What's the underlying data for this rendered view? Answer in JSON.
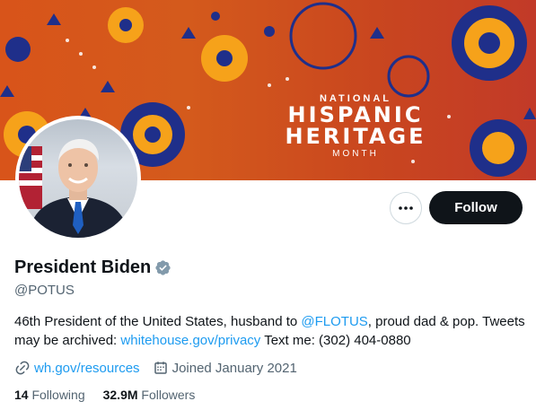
{
  "banner": {
    "line1": "NATIONAL",
    "line2": "HISPANIC",
    "line3": "HERITAGE",
    "line4": "MONTH",
    "colors": {
      "orange": "#d8541a",
      "navy": "#1f2f8a",
      "gold": "#f6a21a",
      "red": "#c23a28"
    }
  },
  "profile": {
    "display_name": "President Biden",
    "handle": "@POTUS",
    "avatar_icon": "profile-photo",
    "verified_icon": "verified-badge-icon"
  },
  "actions": {
    "more_label": "•••",
    "follow_label": "Follow"
  },
  "bio": {
    "part1": "46th President of the United States, husband to ",
    "mention": "@FLOTUS",
    "part2": ", proud dad & pop. Tweets may be archived: ",
    "archive_link": "whitehouse.gov/privacy",
    "part3": " Text me: (302) 404-0880"
  },
  "meta": {
    "website": "wh.gov/resources",
    "joined": "Joined January 2021"
  },
  "stats": {
    "following_count": "14",
    "following_label": "Following",
    "followers_count": "32.9M",
    "followers_label": "Followers"
  },
  "colors": {
    "link": "#1d9bf0",
    "muted": "#536471",
    "text": "#0f1419",
    "verified": "#829aab"
  }
}
